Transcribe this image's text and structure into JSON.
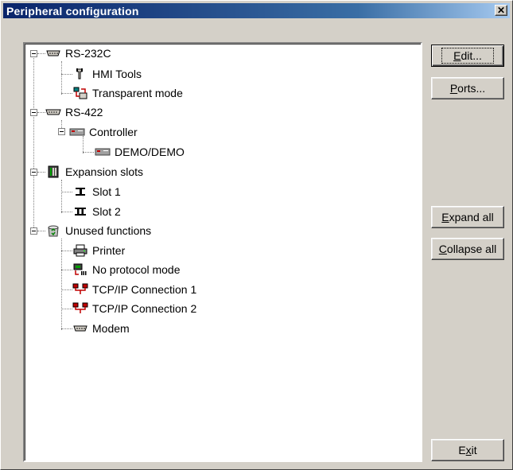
{
  "window": {
    "title": "Peripheral configuration",
    "close_glyph": "✕"
  },
  "tree": {
    "rs232": {
      "label": "RS-232C",
      "icon": "serial-port-icon"
    },
    "hmi_tools": {
      "label": "HMI Tools",
      "icon": "tools-icon"
    },
    "transparent": {
      "label": "Transparent mode",
      "icon": "transparent-mode-icon"
    },
    "rs422": {
      "label": "RS-422",
      "icon": "serial-port-icon"
    },
    "controller": {
      "label": "Controller",
      "icon": "controller-icon"
    },
    "demo": {
      "label": "DEMO/DEMO",
      "icon": "controller-icon"
    },
    "expansion": {
      "label": "Expansion slots",
      "icon": "expansion-slots-icon"
    },
    "slot1": {
      "label": "Slot 1",
      "icon": "slot-one-icon"
    },
    "slot2": {
      "label": "Slot 2",
      "icon": "slot-two-icon"
    },
    "unused": {
      "label": "Unused functions",
      "icon": "recycle-bin-icon"
    },
    "printer": {
      "label": "Printer",
      "icon": "printer-icon"
    },
    "no_protocol": {
      "label": "No protocol mode",
      "icon": "no-protocol-icon"
    },
    "tcp1": {
      "label": "TCP/IP Connection 1",
      "icon": "network-icon"
    },
    "tcp2": {
      "label": "TCP/IP Connection 2",
      "icon": "network-icon"
    },
    "modem": {
      "label": "Modem",
      "icon": "modem-icon"
    }
  },
  "buttons": {
    "edit": {
      "pre": "",
      "key": "E",
      "post": "dit..."
    },
    "ports": {
      "pre": "",
      "key": "P",
      "post": "orts..."
    },
    "expand_all": {
      "pre": "",
      "key": "E",
      "post": "xpand all"
    },
    "collapse_all": {
      "pre": "",
      "key": "C",
      "post": "ollapse all"
    },
    "exit": {
      "pre": "E",
      "key": "x",
      "post": "it"
    }
  },
  "colors": {
    "title_bar": "#0a246a",
    "face": "#d4d0c8",
    "tree_bg": "#ffffff"
  }
}
